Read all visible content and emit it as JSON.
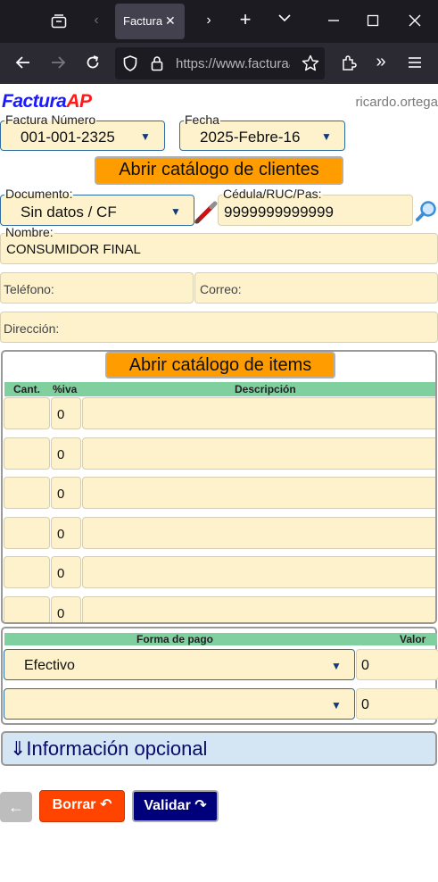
{
  "browser": {
    "tab_title": "Factura/",
    "url": "https://www.facturaap",
    "icons": [
      "tab-overview-icon",
      "tab-back-icon",
      "tab-close-icon",
      "tab-forward-icon",
      "new-tab-icon",
      "tab-list-icon",
      "minimize-icon",
      "maximize-icon",
      "window-close-icon",
      "back-icon",
      "forward-icon",
      "reload-icon",
      "shield-icon",
      "lock-icon",
      "bookmark-star-icon",
      "extensions-icon",
      "overflow-icon",
      "menu-icon"
    ]
  },
  "app": {
    "logo_part1": "Factura",
    "logo_part2": "AP",
    "user": "ricardo.ortega",
    "invoice_number": {
      "label": "Factura Número",
      "value": "001-001-2325"
    },
    "date": {
      "label": "Fecha",
      "value": "2025-Febre-16"
    },
    "open_clients_button": "Abrir catálogo de clientes",
    "document": {
      "label": "Documento:",
      "value": "Sin datos / CF"
    },
    "id_field": {
      "label": "Cédula/RUC/Pas:",
      "value": "9999999999999"
    },
    "name": {
      "label": "Nombre:",
      "value": "CONSUMIDOR FINAL"
    },
    "phone_placeholder": "Teléfono:",
    "email_placeholder": "Correo:",
    "address_placeholder": "Dirección:",
    "open_items_button": "Abrir catálogo de items",
    "items_table": {
      "headers": [
        "Cant.",
        "%iva",
        "Descripción"
      ],
      "rows": [
        {
          "qty": "",
          "iva": "0",
          "desc": ""
        },
        {
          "qty": "",
          "iva": "0",
          "desc": ""
        },
        {
          "qty": "",
          "iva": "0",
          "desc": ""
        },
        {
          "qty": "",
          "iva": "0",
          "desc": ""
        },
        {
          "qty": "",
          "iva": "0",
          "desc": ""
        },
        {
          "qty": "",
          "iva": "0",
          "desc": ""
        }
      ]
    },
    "payment": {
      "headers": [
        "Forma de pago",
        "Valor"
      ],
      "rows": [
        {
          "method": "Efectivo",
          "value": "0"
        },
        {
          "method": "",
          "value": "0"
        }
      ]
    },
    "optional_info": "⇓Información opcional",
    "back_button": "←",
    "delete_button": "Borrar ↶",
    "validate_button": "Validar ↷",
    "colors": {
      "brand_blue": "#1a1aff",
      "brand_red": "#ff1a1a",
      "field_bg": "#fdf2cc",
      "orange_button": "#ff9d00",
      "table_header": "#7fcf9f",
      "delete_button": "#ff4400",
      "validate_button": "#00007a"
    }
  }
}
